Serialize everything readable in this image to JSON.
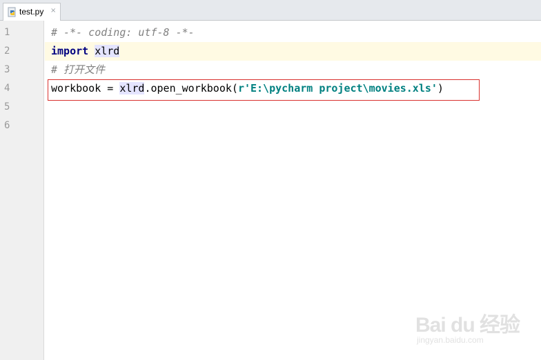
{
  "tab": {
    "filename": "test.py",
    "icon": "python-file-icon",
    "close": "×"
  },
  "gutter": {
    "line_numbers": [
      "1",
      "2",
      "3",
      "4",
      "5",
      "6"
    ]
  },
  "editor": {
    "current_line": 2,
    "lines": {
      "l1": {
        "comment": "# -*- coding: utf-8 -*-"
      },
      "l2": {
        "keyword": "import",
        "space": " ",
        "module": "xlrd"
      },
      "l3": {
        "comment": "# 打开文件"
      },
      "l4": {
        "var": "workbook = ",
        "module": "xlrd",
        "call": ".open_workbook(",
        "string": "r'E:\\pycharm project\\movies.xls'",
        "close": ")"
      }
    },
    "highlight_box_color": "#d9302c"
  },
  "watermark": {
    "brand": "Bai du 经验",
    "sub": "jingyan.baidu.com"
  }
}
